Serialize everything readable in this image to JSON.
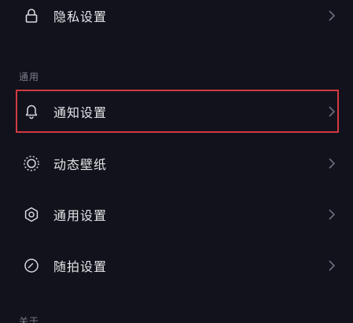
{
  "rows": [
    {
      "label": "隐私设置",
      "icon": "lock-icon"
    },
    {
      "label": "通知设置",
      "icon": "bell-icon"
    },
    {
      "label": "动态壁纸",
      "icon": "wallpaper-icon"
    },
    {
      "label": "通用设置",
      "icon": "gear-icon"
    },
    {
      "label": "随拍设置",
      "icon": "camera-circle-icon"
    }
  ],
  "sections": {
    "general": "通用",
    "bottom": "关于"
  },
  "colors": {
    "background": "#11121b",
    "highlight_border": "#d33a42",
    "text": "#e4e4e8",
    "muted": "#7d7f8a"
  }
}
